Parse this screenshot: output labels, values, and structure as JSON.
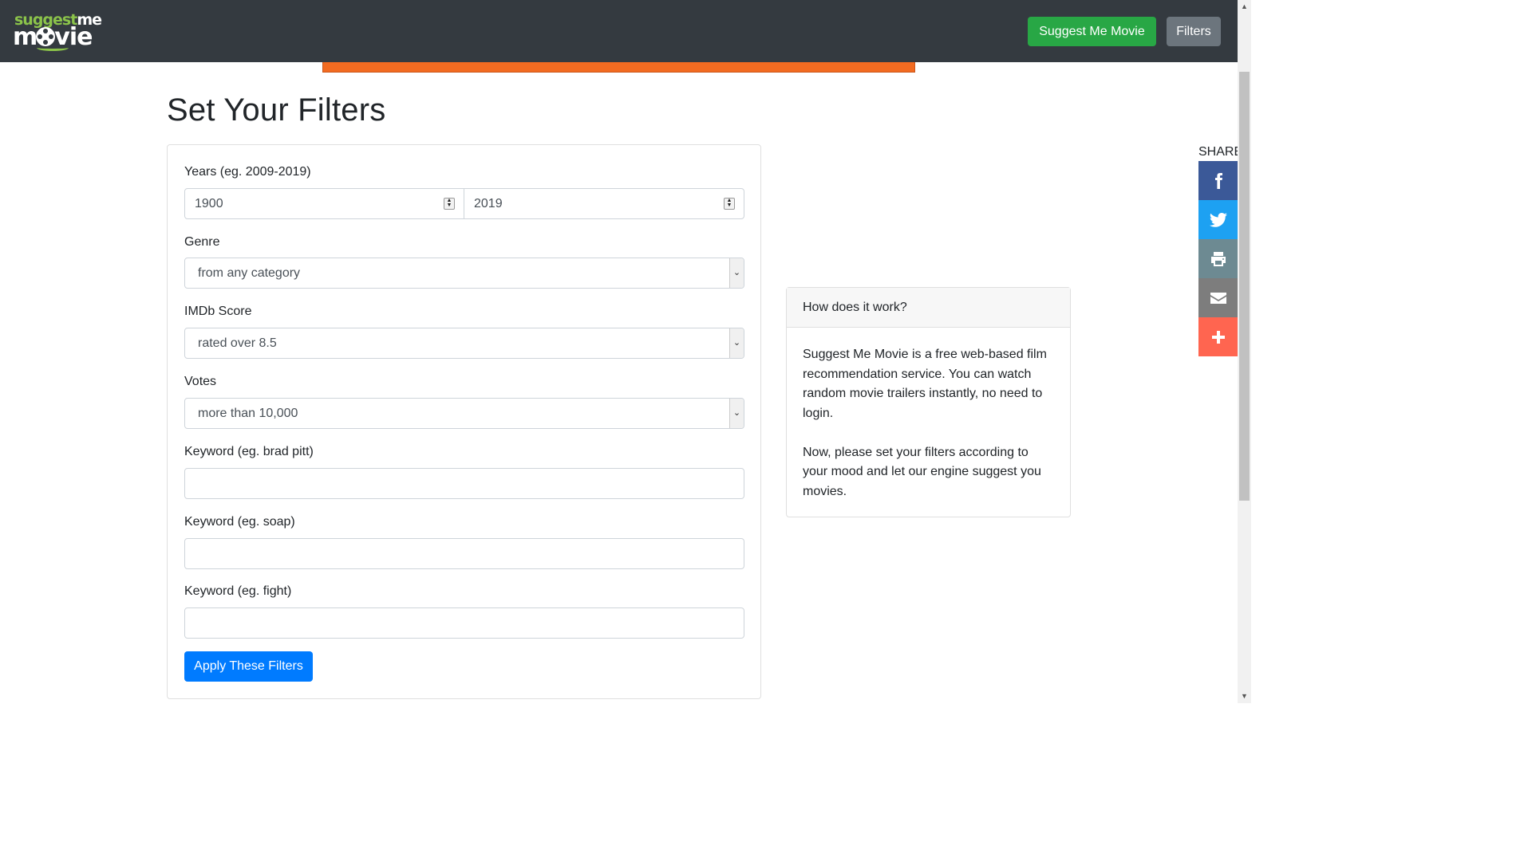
{
  "navbar": {
    "logo_top_green": "suggest",
    "logo_top_white": "me",
    "logo_bottom_left": "m",
    "logo_bottom_right": "vie",
    "suggest_label": "Suggest Me Movie",
    "filters_label": "Filters"
  },
  "page_title": "Set Your Filters",
  "filters": {
    "years_label": "Years (eg. 2009-2019)",
    "year_from": "1900",
    "year_to": "2019",
    "genre_label": "Genre",
    "genre_value": "from any category",
    "imdb_label": "IMDb Score",
    "imdb_value": "rated over 8.5",
    "votes_label": "Votes",
    "votes_value": "more than 10,000",
    "keyword1_label": "Keyword (eg. brad pitt)",
    "keyword1_value": "",
    "keyword2_label": "Keyword (eg. soap)",
    "keyword2_value": "",
    "keyword3_label": "Keyword (eg. fight)",
    "keyword3_value": "",
    "apply_label": "Apply These Filters"
  },
  "info": {
    "heading": "How does it work?",
    "paragraph1": "Suggest Me Movie is a free web-based film recommendation service. You can watch random movie trailers instantly, no need to login.",
    "paragraph2": "Now, please set your filters according to your mood and let our engine suggest you movies."
  },
  "share": {
    "label": "SHARE",
    "buttons": [
      {
        "icon": "facebook-icon",
        "color": "#3b5998"
      },
      {
        "icon": "twitter-icon",
        "color": "#1da1f2"
      },
      {
        "icon": "print-icon",
        "color": "#6d8a92"
      },
      {
        "icon": "email-icon",
        "color": "#7d7d7d"
      },
      {
        "icon": "plus-icon",
        "color": "#ff6550"
      }
    ]
  },
  "colors": {
    "navbar_bg": "#343a40",
    "accent_green": "#28a745",
    "accent_blue": "#007bff",
    "accent_orange": "#f26b21"
  }
}
